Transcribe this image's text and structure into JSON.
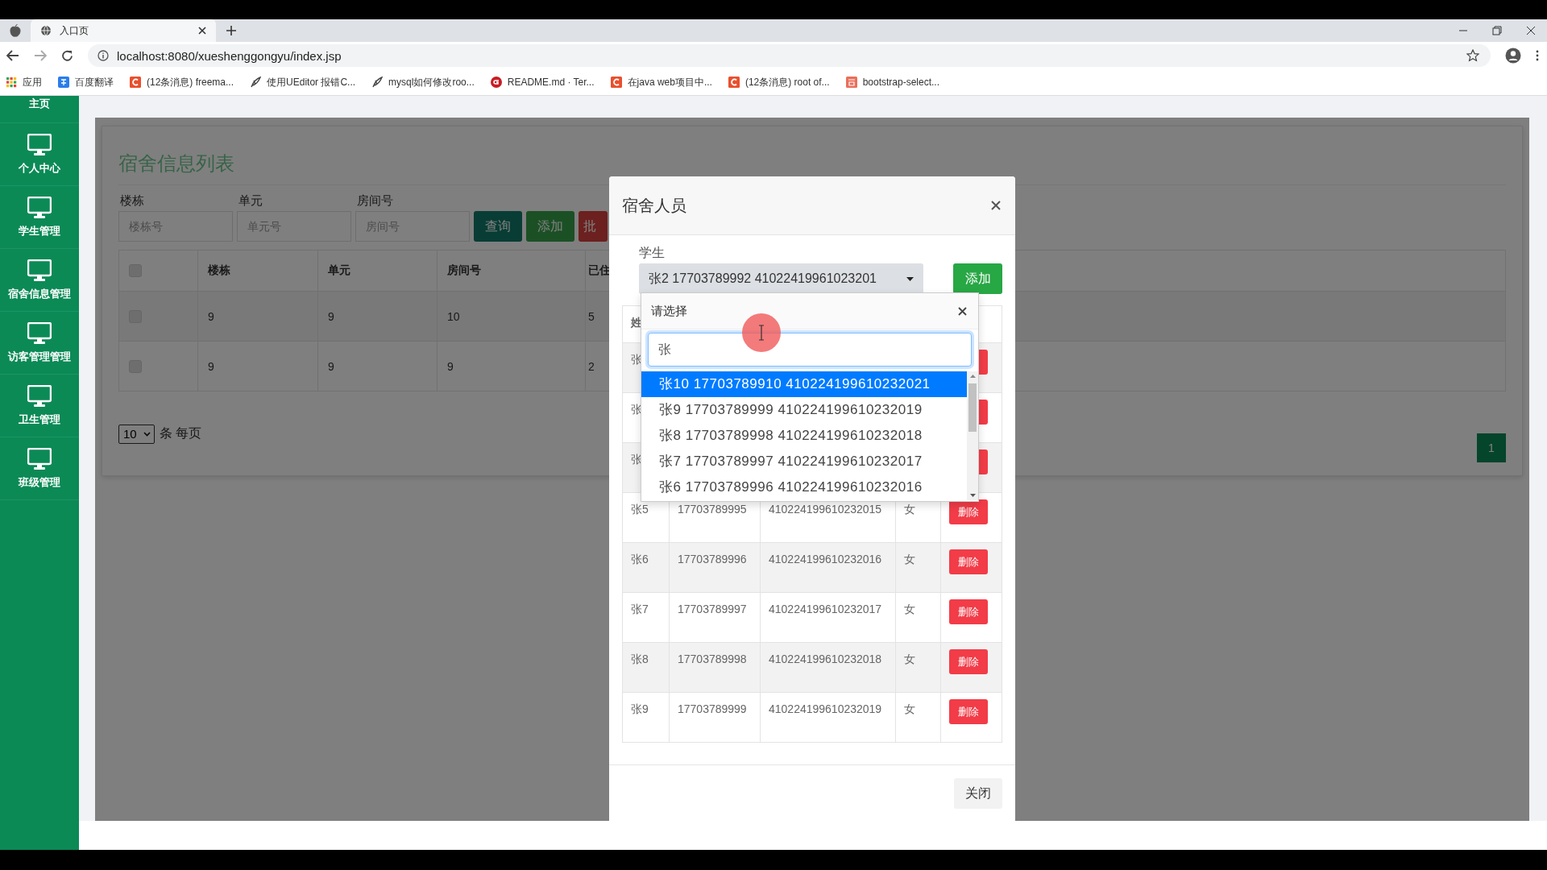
{
  "browser": {
    "tab_title": "入口页",
    "url": "localhost:8080/xueshenggongyu/index.jsp",
    "bookmarks": [
      {
        "label": "应用",
        "kind": "apps"
      },
      {
        "label": "百度翻译",
        "kind": "translate"
      },
      {
        "label": "(12条消息) freema...",
        "kind": "csdn"
      },
      {
        "label": "使用UEditor 报错C...",
        "kind": "quill"
      },
      {
        "label": "mysql如何修改roo...",
        "kind": "quill"
      },
      {
        "label": "README.md · Ter...",
        "kind": "gitee"
      },
      {
        "label": "在java web项目中...",
        "kind": "csdn"
      },
      {
        "label": "(12条消息) root of...",
        "kind": "csdn"
      },
      {
        "label": "bootstrap-select...",
        "kind": "jianshu"
      }
    ]
  },
  "sidebar": {
    "items": [
      {
        "label": "主页"
      },
      {
        "label": "个人中心"
      },
      {
        "label": "学生管理"
      },
      {
        "label": "宿舍信息管理"
      },
      {
        "label": "访客管理管理"
      },
      {
        "label": "卫生管理"
      },
      {
        "label": "班级管理"
      }
    ]
  },
  "page": {
    "title": "宿舍信息列表",
    "filters": [
      {
        "label": "楼栋",
        "placeholder": "楼栋号"
      },
      {
        "label": "单元",
        "placeholder": "单元号"
      },
      {
        "label": "房间号",
        "placeholder": "房间号"
      }
    ],
    "buttons": [
      {
        "label": "查询",
        "kind": "query"
      },
      {
        "label": "添加",
        "kind": "add"
      },
      {
        "label": "批",
        "kind": "batch"
      }
    ],
    "table": {
      "header_checked": false,
      "columns": [
        "楼栋",
        "单元",
        "房间号",
        "已住"
      ],
      "rows": [
        {
          "checked": false,
          "cells": [
            "9",
            "9",
            "10",
            "5"
          ]
        },
        {
          "checked": false,
          "cells": [
            "9",
            "9",
            "9",
            "2"
          ]
        }
      ]
    },
    "page_size": "10",
    "page_size_suffix": "条 每页",
    "pages": [
      {
        "label": "1",
        "selected": true
      }
    ]
  },
  "modal": {
    "title": "宿舍人员",
    "field_label": "学生",
    "select_value": "张2 17703789992 41022419961023201",
    "add_button": "添加",
    "table": {
      "columns": [
        {
          "label": "姓"
        }
      ],
      "rows": [
        {
          "kind": "covered",
          "name": "张"
        },
        {
          "kind": "covered",
          "name": "张"
        },
        {
          "kind": "covered",
          "name": "张"
        },
        {
          "kind": "full",
          "name": "张5",
          "phone": "17703789995",
          "id_card": "410224199610232015",
          "gender": "女",
          "action": "删除"
        },
        {
          "kind": "full",
          "name": "张6",
          "phone": "17703789996",
          "id_card": "410224199610232016",
          "gender": "女",
          "action": "删除"
        },
        {
          "kind": "full",
          "name": "张7",
          "phone": "17703789997",
          "id_card": "410224199610232017",
          "gender": "女",
          "action": "删除"
        },
        {
          "kind": "full",
          "name": "张8",
          "phone": "17703789998",
          "id_card": "410224199610232018",
          "gender": "女",
          "action": "删除"
        },
        {
          "kind": "full",
          "name": "张9",
          "phone": "17703789999",
          "id_card": "410224199610232019",
          "gender": "女",
          "action": "删除"
        }
      ]
    },
    "close_button": "关闭",
    "dropdown": {
      "title": "请选择",
      "search_value": "张",
      "options": [
        {
          "label": "张10 17703789910 410224199610232021",
          "selected": true
        },
        {
          "label": "张9 17703789999 410224199610232019",
          "selected": false
        },
        {
          "label": "张8 17703789998 410224199610232018",
          "selected": false
        },
        {
          "label": "张7 17703789997 410224199610232017",
          "selected": false
        },
        {
          "label": "张6 17703789996 410224199610232016",
          "selected": false
        }
      ]
    }
  }
}
